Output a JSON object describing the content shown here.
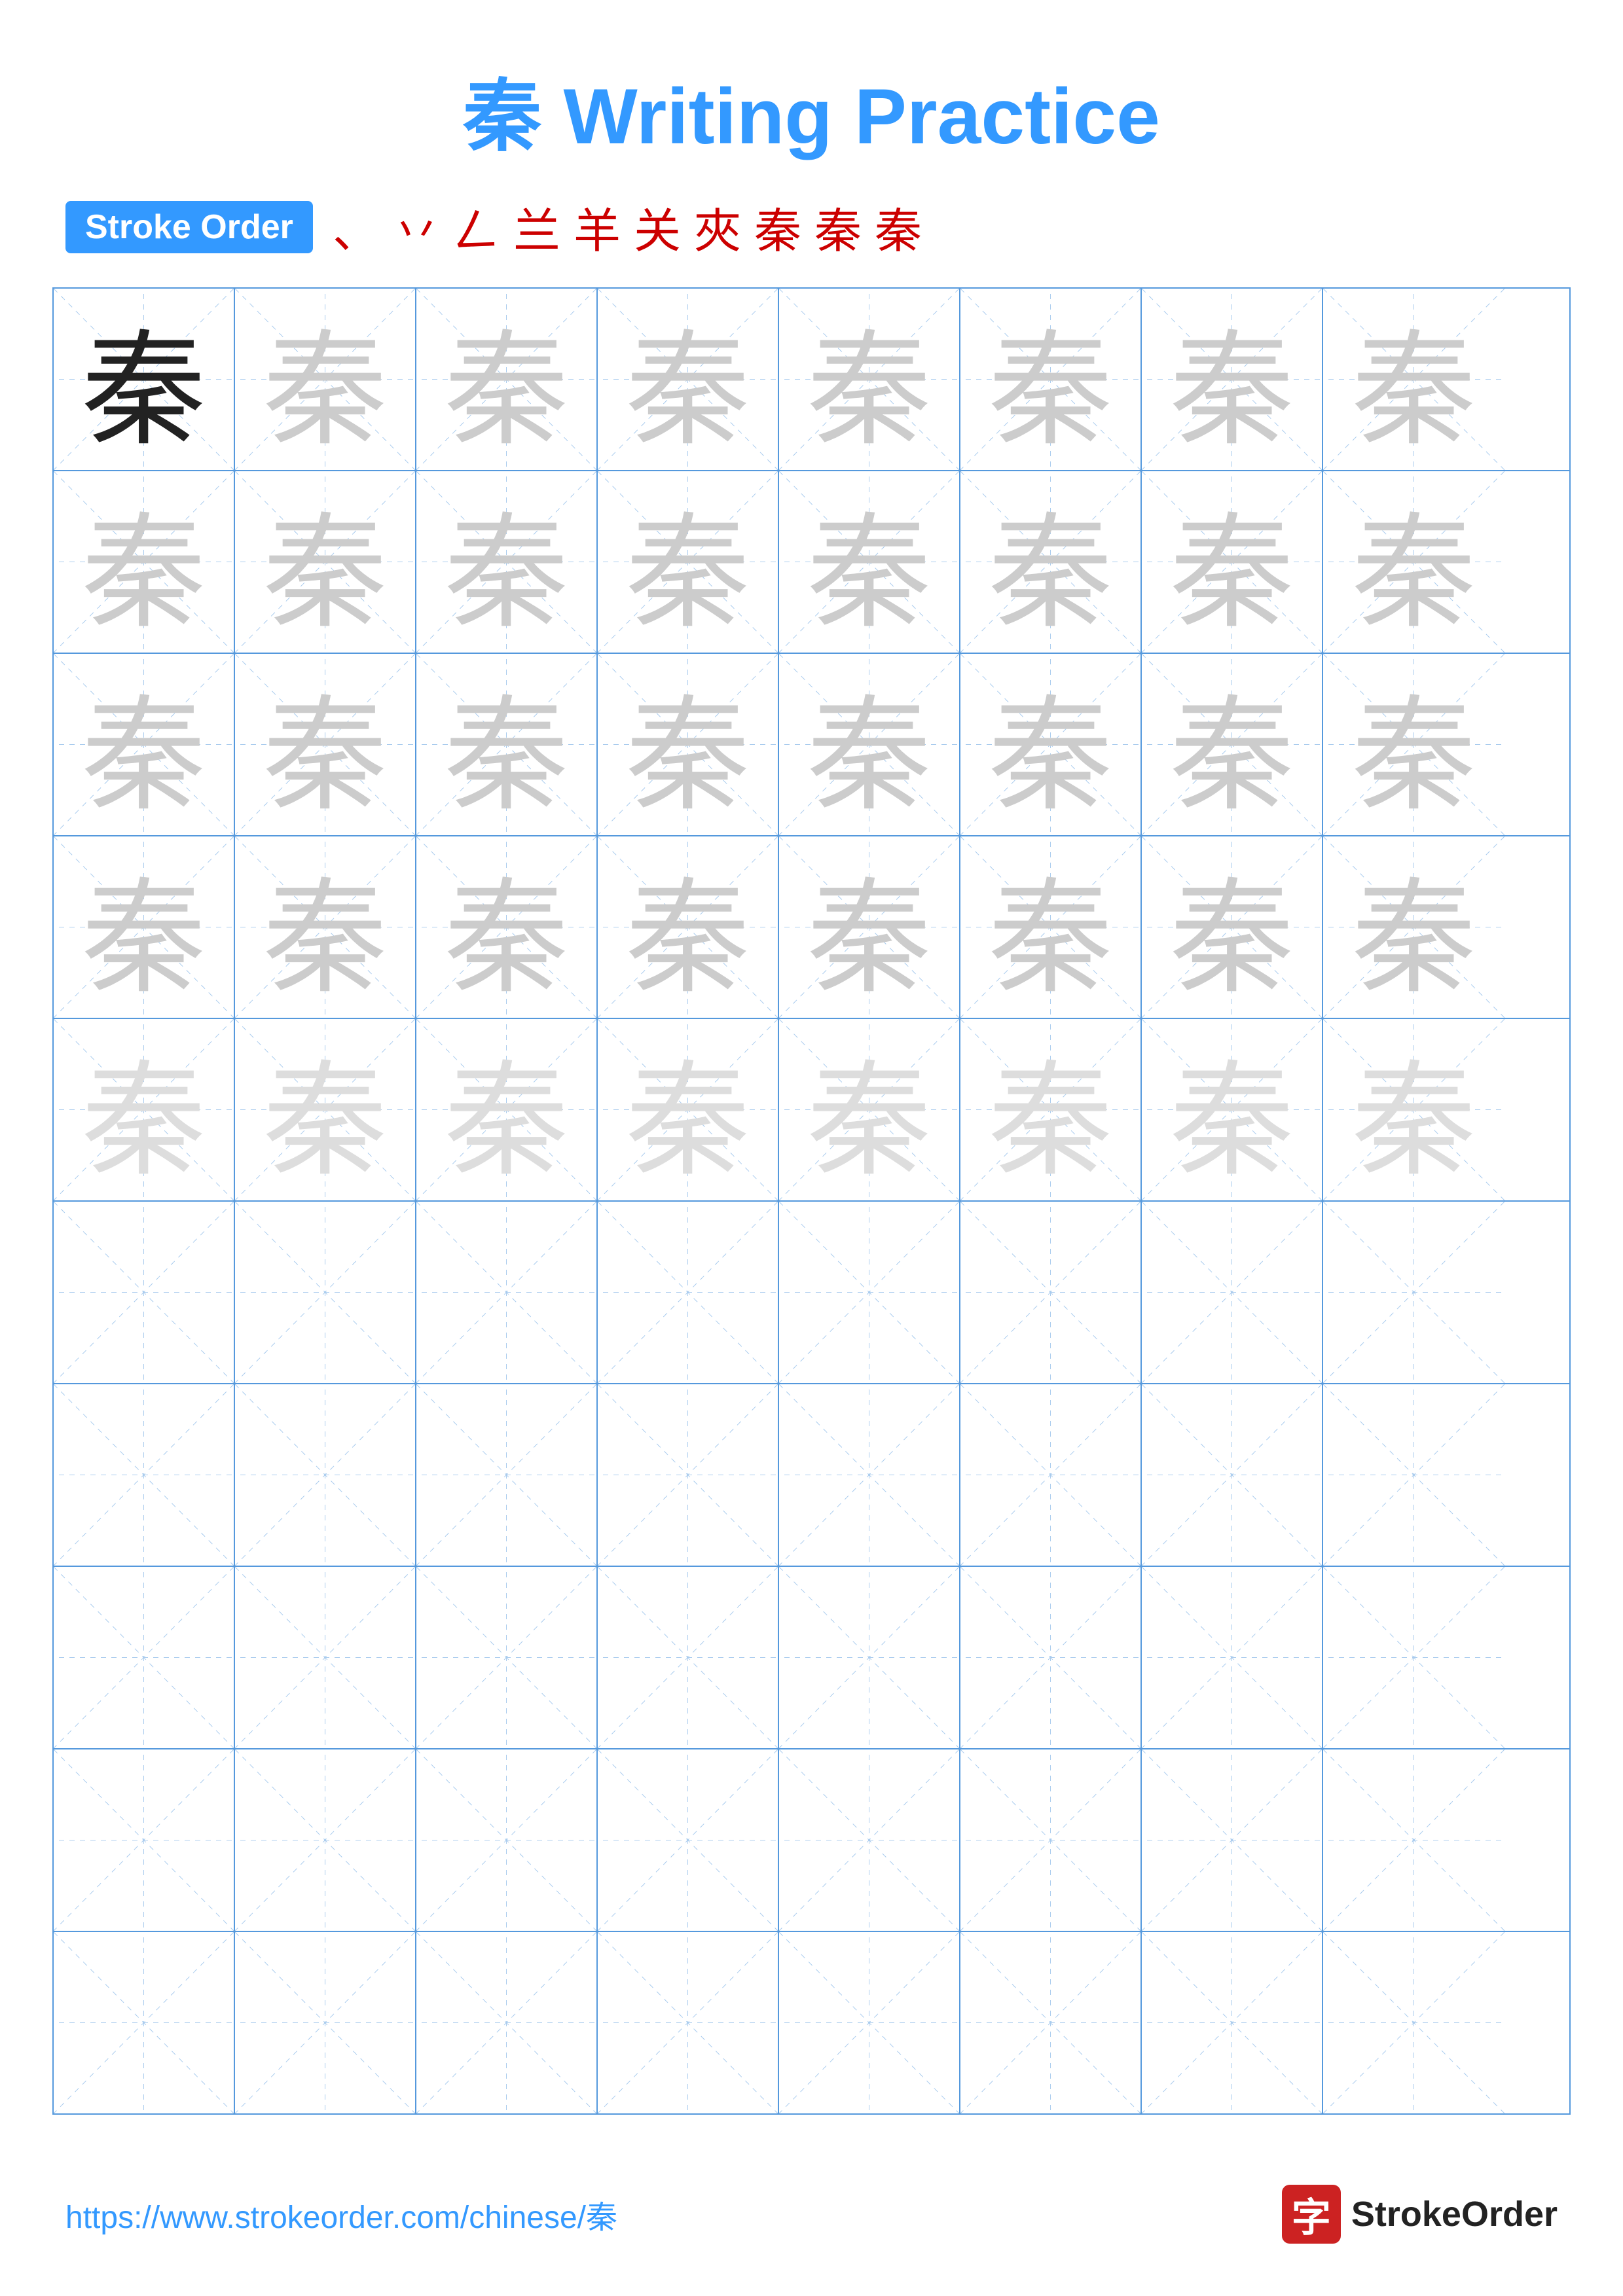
{
  "title": {
    "char": "秦",
    "text": "Writing Practice",
    "full": "秦 Writing Practice"
  },
  "stroke_order": {
    "badge_label": "Stroke Order",
    "strokes": [
      "、",
      "丷",
      "𠃋",
      "兰",
      "羊",
      "关",
      "夾",
      "秦",
      "秦",
      "秦"
    ]
  },
  "grid": {
    "rows": 10,
    "cols": 8,
    "character": "秦",
    "char_rows_with_ghost": 5,
    "char_rows_empty": 5
  },
  "footer": {
    "url": "https://www.strokeorder.com/chinese/秦",
    "logo_char": "字",
    "logo_text": "StrokeOrder"
  }
}
